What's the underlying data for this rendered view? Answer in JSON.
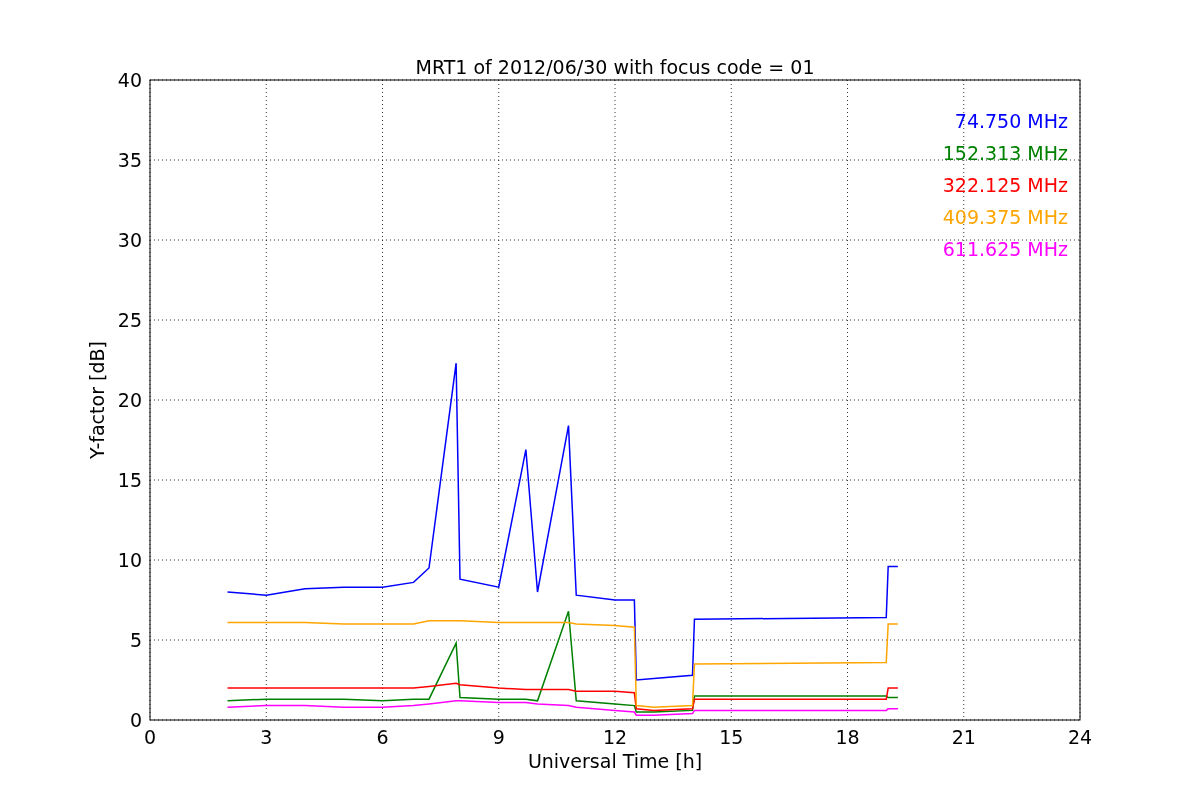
{
  "figure": {
    "chart_data": {
      "type": "line",
      "title": "MRT1 of 2012/06/30 with focus code = 01",
      "xlabel": "Universal Time [h]",
      "ylabel": "Y-factor [dB]",
      "grid": true,
      "xlim": [
        0,
        24
      ],
      "ylim": [
        0,
        40
      ],
      "xticks": [
        0,
        3,
        6,
        9,
        12,
        15,
        18,
        21,
        24
      ],
      "yticks": [
        0,
        5,
        10,
        15,
        20,
        25,
        30,
        35,
        40
      ],
      "x": [
        2,
        3,
        4,
        5,
        6,
        6.8,
        7.2,
        7.9,
        8,
        9,
        9.7,
        10,
        10.8,
        11,
        12,
        12.5,
        12.55,
        13,
        14,
        14.05,
        19,
        19.05,
        19.3
      ],
      "series": [
        {
          "name": "74.750 MHz",
          "color": "#0000ff",
          "values": [
            8,
            7.8,
            8.2,
            8.3,
            8.3,
            8.6,
            9.5,
            22.3,
            8.8,
            8.3,
            16.9,
            8,
            18.4,
            7.8,
            7.5,
            7.5,
            2.5,
            2.6,
            2.8,
            6.3,
            6.4,
            9.6,
            9.6
          ]
        },
        {
          "name": "152.313 MHz",
          "color": "#008000",
          "values": [
            1.2,
            1.3,
            1.3,
            1.3,
            1.2,
            1.3,
            1.3,
            4.8,
            1.4,
            1.3,
            1.3,
            1.2,
            6.8,
            1.2,
            1,
            0.9,
            0.5,
            0.5,
            0.6,
            1.5,
            1.5,
            1.4,
            1.4
          ]
        },
        {
          "name": "322.125 MHz",
          "color": "#ff0000",
          "values": [
            2,
            2,
            2,
            2,
            2,
            2,
            2.1,
            2.3,
            2.2,
            2,
            1.9,
            1.9,
            1.9,
            1.8,
            1.8,
            1.7,
            0.7,
            0.6,
            0.7,
            1.3,
            1.3,
            2,
            2
          ]
        },
        {
          "name": "409.375 MHz",
          "color": "#ffa500",
          "values": [
            6.1,
            6.1,
            6.1,
            6,
            6,
            6,
            6.2,
            6.2,
            6.2,
            6.1,
            6.1,
            6.1,
            6.1,
            6,
            5.9,
            5.8,
            0.9,
            0.8,
            0.9,
            3.5,
            3.6,
            6,
            6
          ]
        },
        {
          "name": "611.625 MHz",
          "color": "#ff00ff",
          "values": [
            0.8,
            0.9,
            0.9,
            0.8,
            0.8,
            0.9,
            1,
            1.2,
            1.2,
            1.1,
            1.1,
            1,
            0.9,
            0.8,
            0.6,
            0.5,
            0.3,
            0.3,
            0.4,
            0.6,
            0.6,
            0.7,
            0.7
          ]
        }
      ]
    }
  }
}
